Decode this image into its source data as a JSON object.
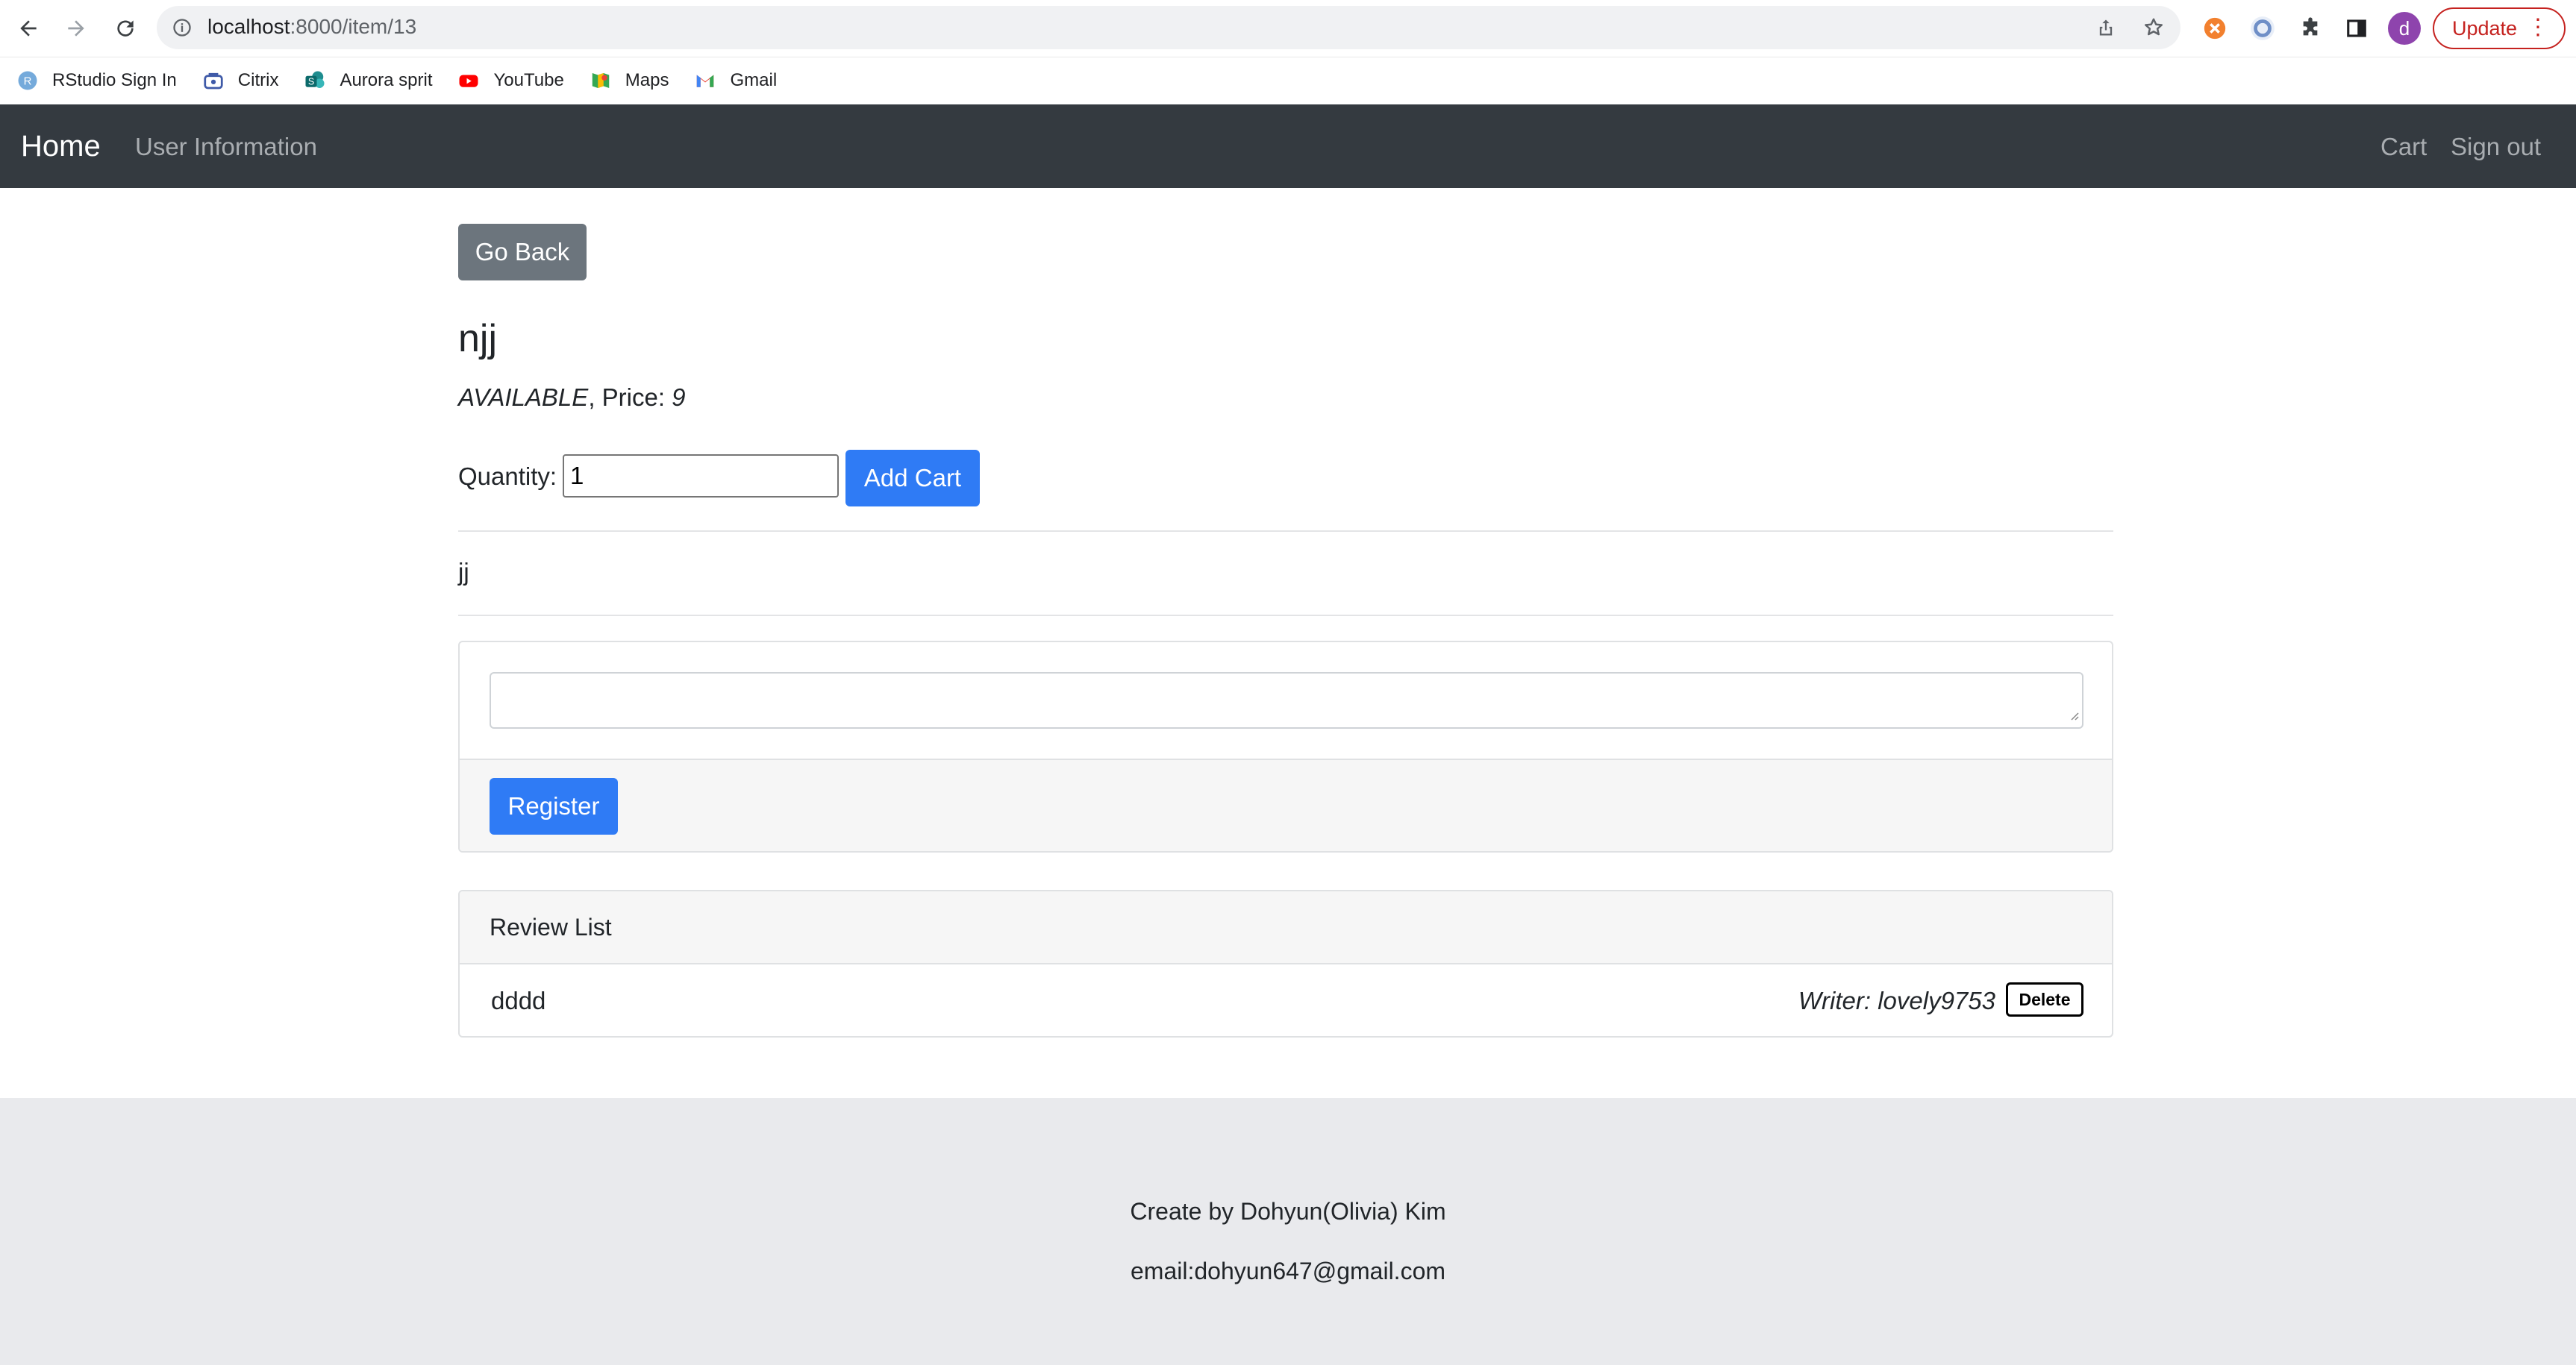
{
  "browser": {
    "url_host": "localhost",
    "url_path": ":8000/item/13",
    "avatar_letter": "d",
    "update_label": "Update",
    "bookmarks": [
      {
        "label": "RStudio Sign In",
        "icon": "rstudio-icon"
      },
      {
        "label": "Citrix",
        "icon": "citrix-icon"
      },
      {
        "label": "Aurora sprit",
        "icon": "sharepoint-icon"
      },
      {
        "label": "YouTube",
        "icon": "youtube-icon"
      },
      {
        "label": "Maps",
        "icon": "maps-icon"
      },
      {
        "label": "Gmail",
        "icon": "gmail-icon"
      }
    ]
  },
  "navbar": {
    "brand": "Home",
    "user_info": "User Information",
    "cart": "Cart",
    "sign_out": "Sign out"
  },
  "item": {
    "go_back_label": "Go Back",
    "name": "njj",
    "status": "AVAILABLE",
    "price_label": ", Price: ",
    "price": "9",
    "quantity_label": "Quantity:",
    "quantity_value": "1",
    "add_cart_label": "Add Cart",
    "description": "jj"
  },
  "review_form": {
    "text_value": "",
    "register_label": "Register"
  },
  "review_list": {
    "title": "Review List",
    "reviews": [
      {
        "content": "dddd",
        "writer": "Writer: lovely9753",
        "delete_label": "Delete"
      }
    ]
  },
  "footer": {
    "credit": "Create by Dohyun(Olivia) Kim",
    "email": "email:dohyun647@gmail.com"
  },
  "colors": {
    "navbar_bg": "#343a40",
    "primary": "#2f7bf5",
    "secondary": "#6c757d",
    "footer_bg": "#e9eaed"
  }
}
